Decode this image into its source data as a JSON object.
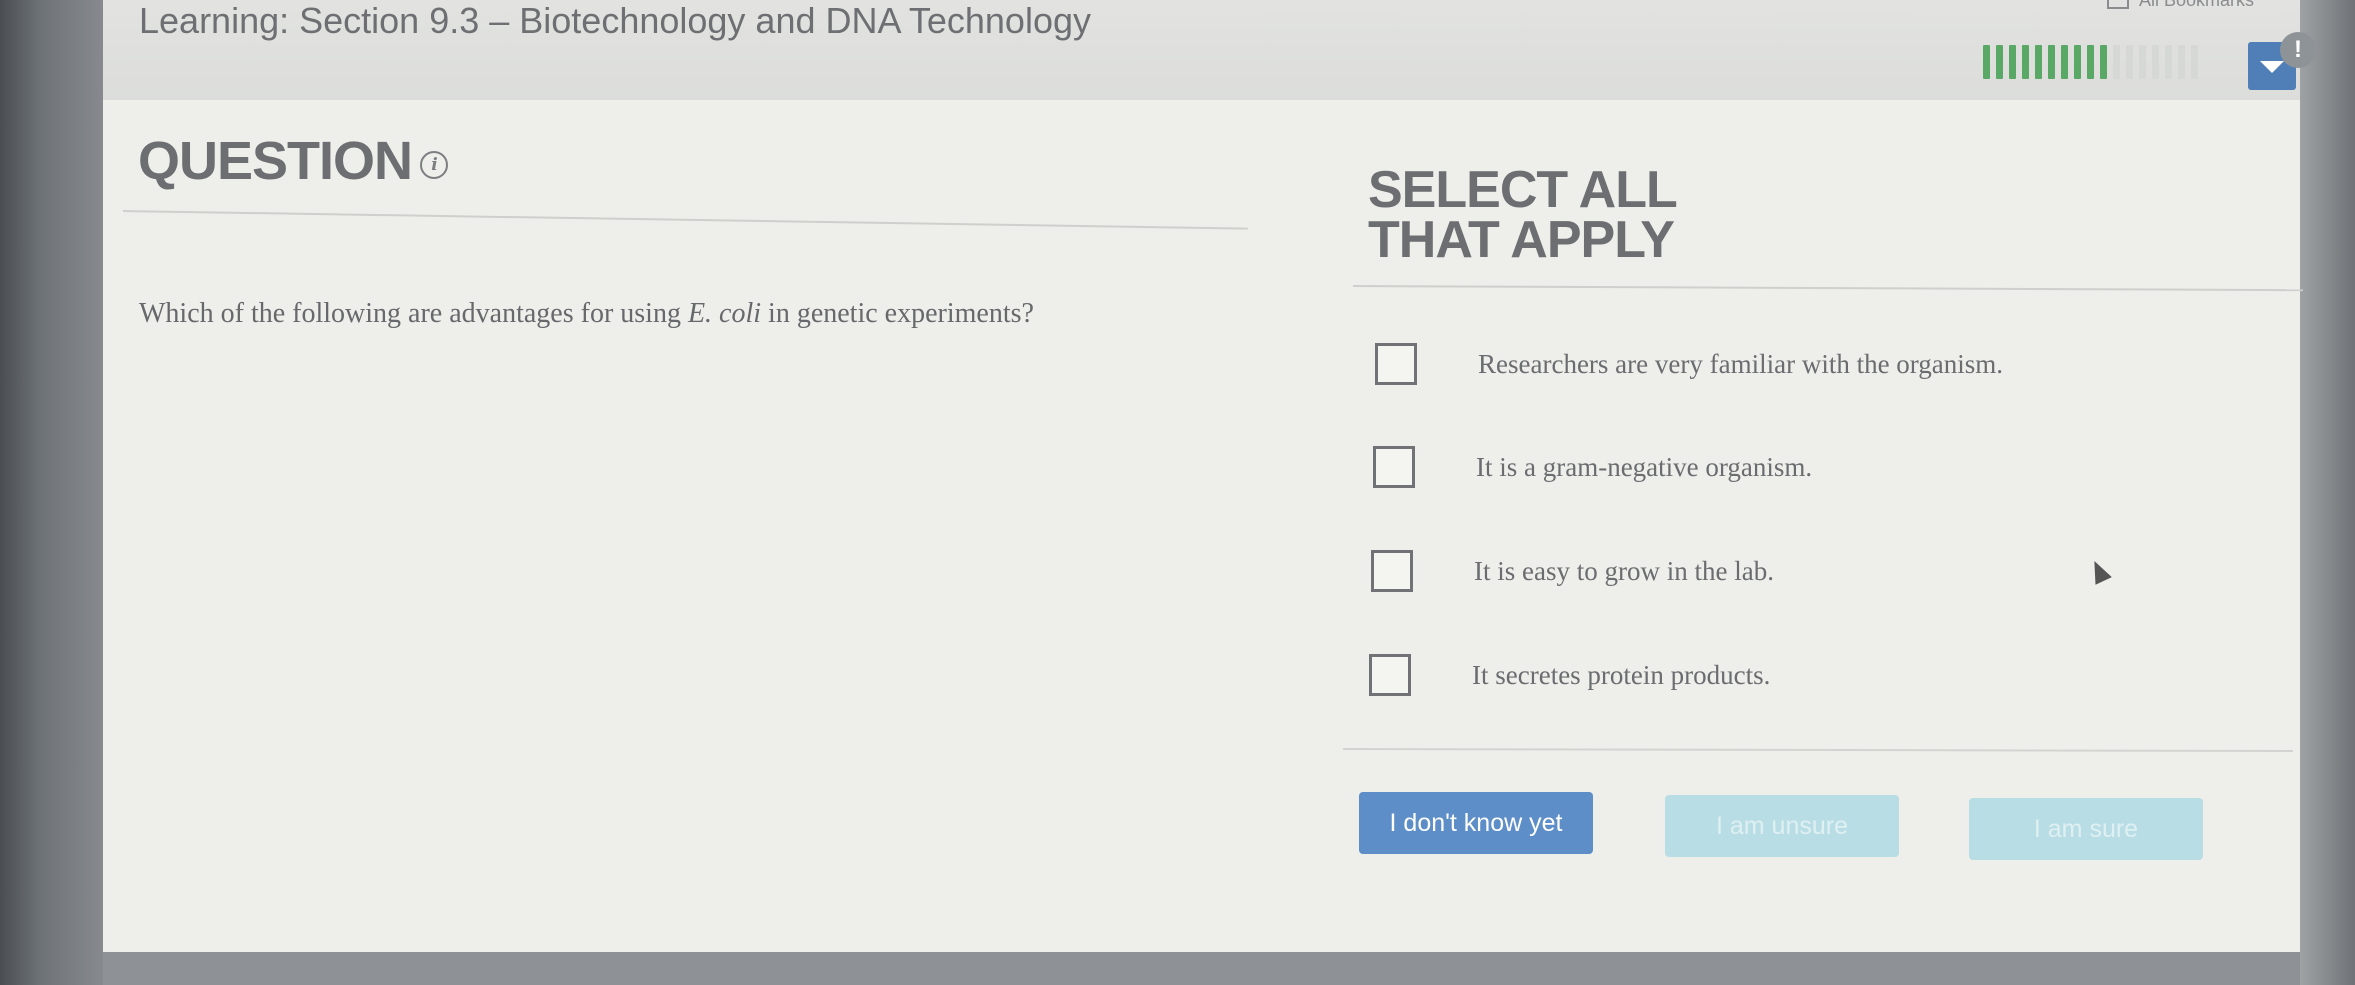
{
  "header": {
    "title": "Learning: Section 9.3 – Biotechnology and DNA Technology",
    "bookmarks_label": "All Bookmarks",
    "progress": {
      "filled": 10,
      "total": 17
    },
    "alert_badge": "!"
  },
  "question": {
    "heading": "QUESTION",
    "info_icon_glyph": "i",
    "text_before": "Which of the following are advantages for using ",
    "text_em": "E. coli",
    "text_after": " in genetic experiments?"
  },
  "answers": {
    "heading": "SELECT ALL THAT APPLY",
    "options": [
      {
        "label": "Researchers are very familiar with the organism.",
        "checked": false
      },
      {
        "label": "It is a gram-negative organism.",
        "checked": false
      },
      {
        "label": "It is easy to grow in the lab.",
        "checked": false
      },
      {
        "label": "It secretes protein products.",
        "checked": false
      }
    ]
  },
  "buttons": {
    "dont_know": "I don't know yet",
    "unsure": "I am unsure",
    "sure": "I am sure"
  },
  "colors": {
    "primary_button": "#5d8ec8",
    "disabled_button": "#b9dde4",
    "progress_on": "#5aa866",
    "dropdown": "#4f7fb6"
  }
}
